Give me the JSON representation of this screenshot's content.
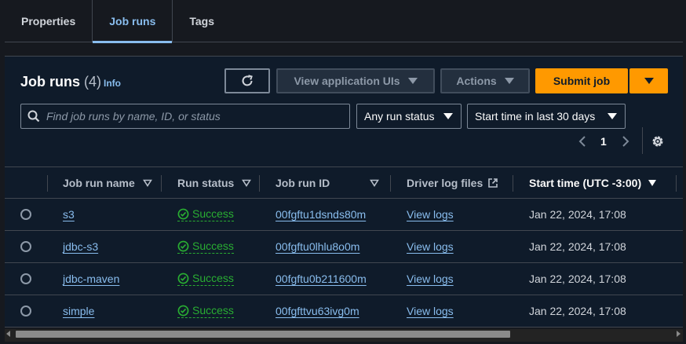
{
  "tabs": [
    {
      "label": "Properties"
    },
    {
      "label": "Job runs"
    },
    {
      "label": "Tags"
    }
  ],
  "header": {
    "title": "Job runs",
    "count": "(4)",
    "info": "Info"
  },
  "toolbar": {
    "refresh_icon": "refresh-icon",
    "view_ui_label": "View application UIs",
    "actions_label": "Actions",
    "submit_label": "Submit job"
  },
  "filters": {
    "search_placeholder": "Find job runs by name, ID, or status",
    "status_select": "Any run status",
    "time_select": "Start time in last 30 days"
  },
  "pagination": {
    "current_page": "1"
  },
  "table": {
    "columns": {
      "name": "Job run name",
      "status": "Run status",
      "id": "Job run ID",
      "logs": "Driver log files",
      "start": "Start time (UTC -3:00)"
    },
    "rows": [
      {
        "name": "s3",
        "status": "Success",
        "id": "00fgftu1dsnds80m",
        "logs": "View logs",
        "start": "Jan 22, 2024, 17:08"
      },
      {
        "name": "jdbc-s3",
        "status": "Success",
        "id": "00fgftu0lhlu8o0m",
        "logs": "View logs",
        "start": "Jan 22, 2024, 17:08"
      },
      {
        "name": "jdbc-maven",
        "status": "Success",
        "id": "00fgftu0b211600m",
        "logs": "View logs",
        "start": "Jan 22, 2024, 17:08"
      },
      {
        "name": "simple",
        "status": "Success",
        "id": "00fgfttvu63ivg0m",
        "logs": "View logs",
        "start": "Jan 22, 2024, 17:08"
      }
    ]
  },
  "colors": {
    "accent": "#89bdee",
    "primary": "#ff9900",
    "success": "#29ad32",
    "background": "#0f1b2a"
  }
}
